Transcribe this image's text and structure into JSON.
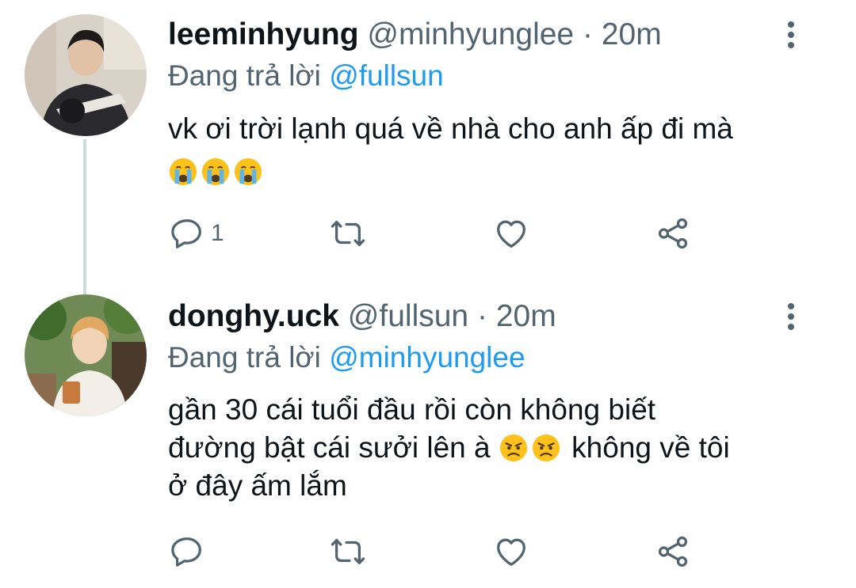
{
  "tweets": [
    {
      "display_name": "leeminhyung",
      "handle": "@minhyunglee",
      "separator": "·",
      "time": "20m",
      "reply_prefix": "Đang trả lời",
      "reply_to": "@fullsun",
      "text_line_1": "vk ơi trời lạnh quá về nhà cho anh ấp đi mà",
      "emojis": [
        "crying-face",
        "crying-face",
        "crying-face"
      ],
      "reply_count": "1"
    },
    {
      "display_name": "donghy.uck",
      "handle": "@fullsun",
      "separator": "·",
      "time": "20m",
      "reply_prefix": "Đang trả lời",
      "reply_to": "@minhyunglee",
      "text_line_1": "gần 30 cái tuổi đầu rồi còn không biết",
      "text_line_2_a": "đường bật cái sưởi lên à",
      "text_line_2_b": "không về tôi",
      "text_line_3": "ở đây ấm lắm",
      "emojis": [
        "angry-face",
        "angry-face"
      ],
      "reply_count": ""
    }
  ],
  "colors": {
    "text": "#0f1419",
    "secondary": "#536471",
    "link": "#1d9bf0",
    "thread_line": "#cfd9de"
  },
  "icons": [
    "reply-icon",
    "retweet-icon",
    "like-icon",
    "share-icon",
    "more-menu-icon"
  ]
}
